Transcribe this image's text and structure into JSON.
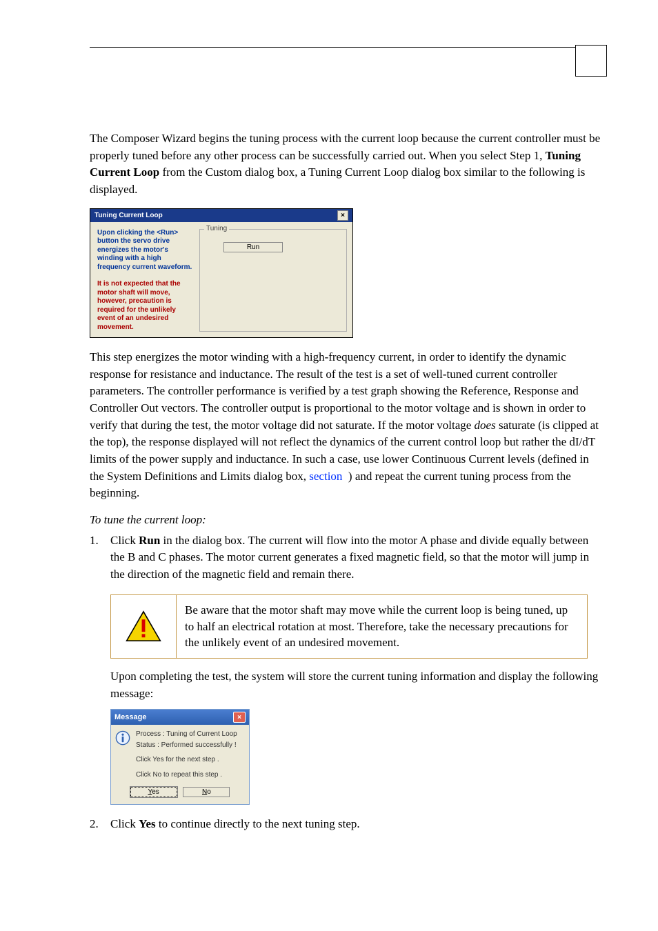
{
  "paragraphs": {
    "intro_a": "The Composer Wizard begins the tuning process with the current loop because the current controller must be properly tuned before any other process can be successfully carried out. When you select Step 1, ",
    "intro_bold": "Tuning Current Loop",
    "intro_b": " from the Custom dialog box, a Tuning Current Loop dialog box similar to the following is displayed.",
    "after_dlg_a": "This step energizes the motor winding with a high-frequency current, in order to identify the dynamic response for resistance and inductance. The result of the test is a set of well-tuned current controller parameters. The controller performance is verified by a test graph showing the Reference, Response and Controller Out vectors. The controller output is proportional to the motor voltage and is shown in order to verify that during the test, the motor voltage did not saturate. If the motor voltage ",
    "after_dlg_emph": "does",
    "after_dlg_b": " saturate (is clipped at the top), the response displayed will not reflect the dynamics of the current control loop but rather the dI/dT limits of the power supply and inductance. In such a case, use lower Continuous Current levels (defined in the System Definitions and Limits dialog box, ",
    "after_dlg_link": "section ‎",
    "after_dlg_c": " ) and repeat the current tuning process from the beginning.",
    "instr_head": "To tune the current loop:",
    "step1_a": "Click ",
    "step1_bold": "Run",
    "step1_b": " in the dialog box. The current will flow into the motor A phase and divide equally between the B and C phases. The motor current generates a fixed magnetic field, so that the motor will jump in the direction of the magnetic field and remain there.",
    "warn_text": "Be aware that the motor shaft may move while the current loop is being tuned, up to half an electrical rotation at most. Therefore, take the necessary precautions for the unlikely event of an undesired movement.",
    "after_warn": "Upon completing the test, the system will store the current tuning information and display the following message:",
    "step2_a": "Click ",
    "step2_bold": "Yes",
    "step2_b": " to continue directly to the next tuning step."
  },
  "dialog1": {
    "title": "Tuning Current Loop",
    "close": "×",
    "left_blue": "Upon clicking the <Run> button the servo drive energizes the motor's winding with a high frequency current waveform.",
    "left_red": "It is not expected that the motor shaft will move, however, precaution is required for the unlikely event of an undesired movement.",
    "fieldset_label": "Tuning",
    "run": "Run"
  },
  "msg": {
    "title": "Message",
    "close": "×",
    "line1": "Process :  Tuning of Current Loop",
    "line2": "Status  :   Performed successfully !",
    "line3": "Click Yes for the next step .",
    "line4": "Click No to repeat this step  .",
    "yes_u": "Y",
    "yes_r": "es",
    "no_u": "N",
    "no_r": "o"
  },
  "list_numbers": {
    "one": "1.",
    "two": "2."
  }
}
